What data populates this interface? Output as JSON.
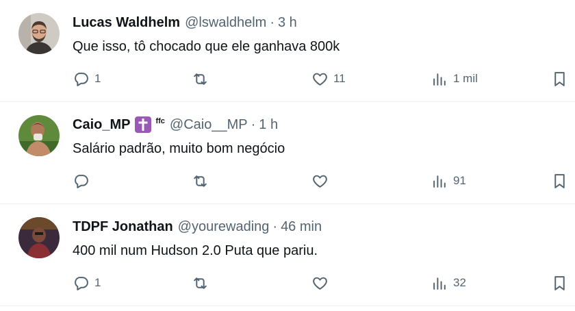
{
  "tweets": [
    {
      "name": "Lucas Waldhelm",
      "handle": "@lswaldhelm",
      "separator": "·",
      "time": "3 h",
      "text": "Que isso, tô chocado que ele ganhava 800k",
      "badge_tag": "",
      "replies": "1",
      "retweets": "",
      "likes": "11",
      "views": "1 mil",
      "avatar_colors": [
        "#cfcac3",
        "#4b3a2f"
      ]
    },
    {
      "name": "Caio_MP",
      "handle": "@Caio__MP",
      "separator": "·",
      "time": "1 h",
      "text": "Salário padrão, muito bom negócio",
      "badge_tag": "ffc",
      "replies": "",
      "retweets": "",
      "likes": "",
      "views": "91",
      "avatar_colors": [
        "#5f8a3c",
        "#b07a5a"
      ]
    },
    {
      "name": "TDPF Jonathan",
      "handle": "@yourewading",
      "separator": "·",
      "time": "46 min",
      "text": "400 mil num Hudson 2.0 Puta que pariu.",
      "badge_tag": "",
      "replies": "1",
      "retweets": "",
      "likes": "",
      "views": "32",
      "avatar_colors": [
        "#3a2a3c",
        "#8a2f34"
      ]
    }
  ],
  "colors": {
    "text_primary": "#0f1419",
    "text_secondary": "#536471",
    "divider": "#eff3f4",
    "badge_bg": "#9b59b6"
  },
  "icons": [
    "reply-icon",
    "retweet-icon",
    "like-icon",
    "views-icon",
    "bookmark-icon",
    "cross-icon"
  ]
}
